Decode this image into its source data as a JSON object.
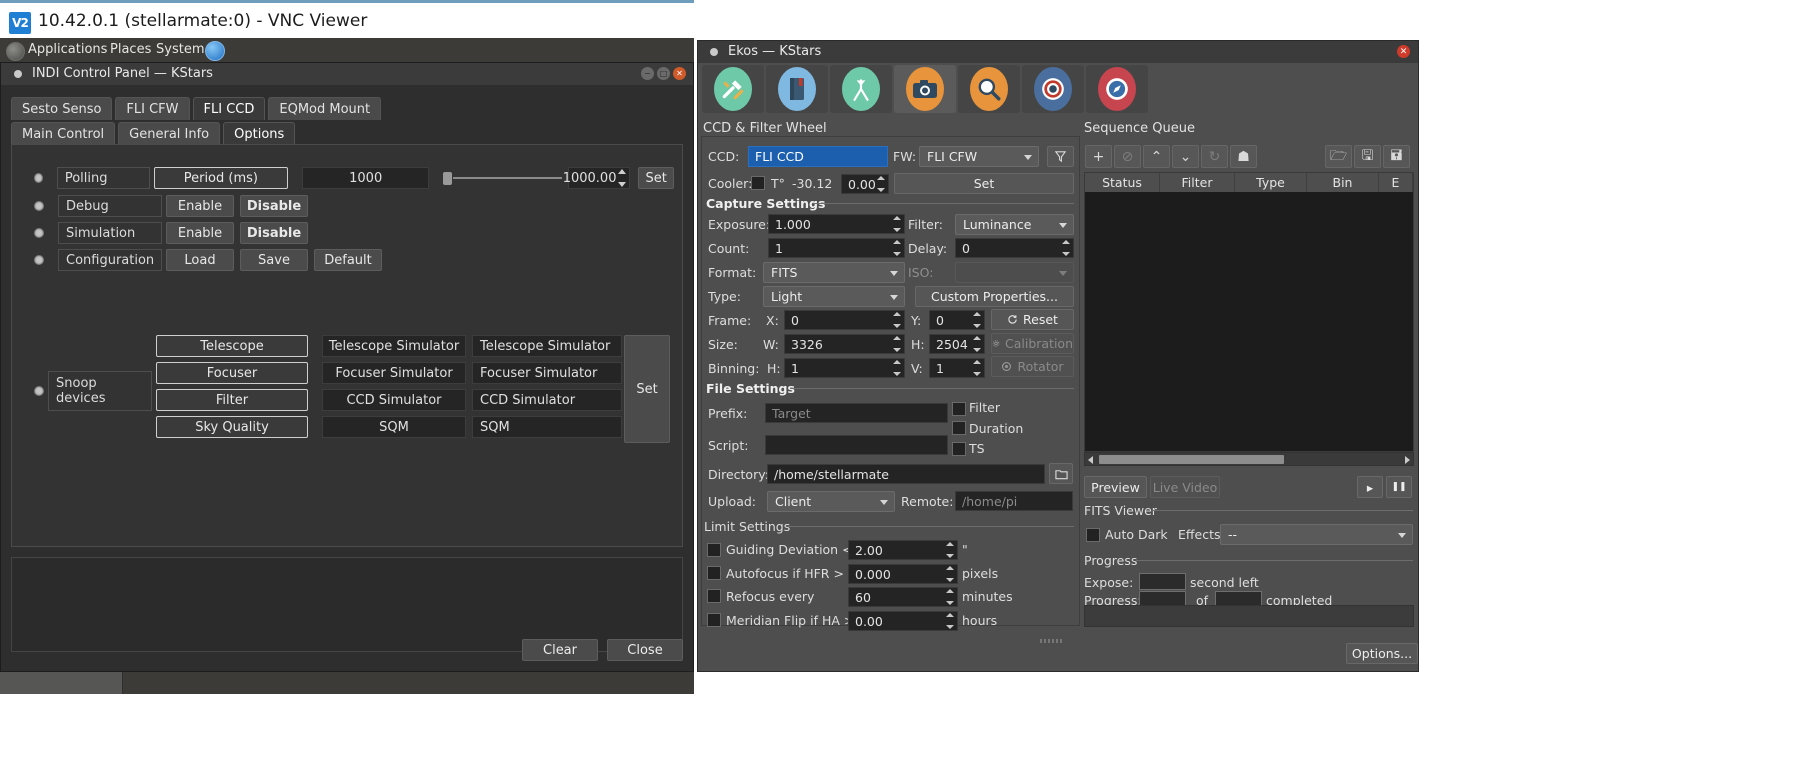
{
  "vnc": {
    "title": "10.42.0.1 (stellarmate:0) - VNC Viewer",
    "logo": "V2"
  },
  "gnome_panel": {
    "applications": "Applications",
    "places": "Places",
    "system": "System"
  },
  "indi_window": {
    "title": "INDI Control Panel — KStars",
    "device_tabs": [
      {
        "label": "Sesto Senso",
        "active": false
      },
      {
        "label": "FLI CFW",
        "active": false
      },
      {
        "label": "FLI CCD",
        "active": true
      },
      {
        "label": "EQMod Mount",
        "active": false
      }
    ],
    "sub_tabs": [
      {
        "label": "Main Control",
        "active": false
      },
      {
        "label": "General Info",
        "active": false
      },
      {
        "label": "Options",
        "active": true
      }
    ],
    "rows": {
      "polling": {
        "label": "Polling",
        "button": "Period (ms)",
        "value": "1000",
        "spin_value": "1000.00",
        "set": "Set"
      },
      "debug": {
        "label": "Debug",
        "enable": "Enable",
        "disable": "Disable"
      },
      "simulation": {
        "label": "Simulation",
        "enable": "Enable",
        "disable": "Disable"
      },
      "configuration": {
        "label": "Configuration",
        "load": "Load",
        "save": "Save",
        "default": "Default"
      },
      "snoop": {
        "label_line1": "Snoop",
        "label_line2": "devices",
        "set": "Set",
        "items": [
          {
            "name": "Telescope",
            "value": "Telescope Simulator",
            "current": "Telescope Simulator"
          },
          {
            "name": "Focuser",
            "value": "Focuser Simulator",
            "current": "Focuser Simulator"
          },
          {
            "name": "Filter",
            "value": "CCD Simulator",
            "current": "CCD Simulator"
          },
          {
            "name": "Sky Quality",
            "value": "SQM",
            "current": "SQM"
          }
        ]
      }
    },
    "footer": {
      "clear": "Clear",
      "close": "Close"
    }
  },
  "ekos": {
    "title": "Ekos — KStars",
    "modules": [
      {
        "name": "setup-module",
        "icon": "tools-icon",
        "active": false,
        "bg": "#6ec9a8"
      },
      {
        "name": "scheduler-module",
        "icon": "book-icon",
        "active": false,
        "bg": "#7fb8e0"
      },
      {
        "name": "mount-module",
        "icon": "tripod-icon",
        "active": false,
        "bg": "#6ec9a8"
      },
      {
        "name": "capture-module",
        "icon": "camera-icon",
        "active": true,
        "bg": "#e8943c"
      },
      {
        "name": "focus-module",
        "icon": "magnifier-icon",
        "active": false,
        "bg": "#e8943c"
      },
      {
        "name": "guide-module",
        "icon": "target-icon",
        "active": false,
        "bg": "#4a6f9e"
      },
      {
        "name": "align-module",
        "icon": "compass-icon",
        "active": false,
        "bg": "#c6454f"
      }
    ],
    "sections": {
      "ccd_filter_wheel": "CCD & Filter Wheel",
      "capture_settings": "Capture Settings",
      "file_settings": "File Settings",
      "limit_settings": "Limit Settings",
      "sequence_queue": "Sequence Queue",
      "fits_viewer": "FITS Viewer",
      "progress": "Progress"
    },
    "ccd": {
      "ccd_label": "CCD:",
      "ccd_value": "FLI CCD",
      "fw_label": "FW:",
      "fw_value": "FLI CFW",
      "filter_icon": "funnel-icon",
      "cooler_label": "Cooler:",
      "temp_symbol": "T°",
      "current_temp": "-30.12",
      "target_temp": "0.00",
      "set_button": "Set"
    },
    "capture": {
      "exposure_label": "Exposure:",
      "exposure_value": "1.000",
      "filter_label": "Filter:",
      "filter_value": "Luminance",
      "count_label": "Count:",
      "count_value": "1",
      "delay_label": "Delay:",
      "delay_value": "0",
      "format_label": "Format:",
      "format_value": "FITS",
      "iso_label": "ISO:",
      "iso_value": "",
      "type_label": "Type:",
      "type_value": "Light",
      "custom_properties": "Custom Properties...",
      "frame_label": "Frame:",
      "frame_x_label": "X:",
      "frame_x": "0",
      "frame_y_label": "Y:",
      "frame_y": "0",
      "reset_button": "Reset",
      "reset_icon": "reset-icon",
      "size_label": "Size:",
      "size_w_label": "W:",
      "size_w": "3326",
      "size_h_label": "H:",
      "size_h": "2504",
      "calibration_button": "Calibration",
      "calibration_icon": "gear-icon",
      "binning_label": "Binning:",
      "bin_h_label": "H:",
      "bin_h": "1",
      "bin_v_label": "V:",
      "bin_v": "1",
      "rotator_button": "Rotator",
      "rotator_icon": "rotator-icon"
    },
    "file": {
      "prefix_label": "Prefix:",
      "prefix_placeholder": "Target",
      "filter_check": "Filter",
      "duration_check": "Duration",
      "ts_check": "TS",
      "script_label": "Script:",
      "script_value": "",
      "directory_label": "Directory:",
      "directory_value": "/home/stellarmate",
      "browse_icon": "folder-icon",
      "upload_label": "Upload:",
      "upload_value": "Client",
      "remote_label": "Remote:",
      "remote_placeholder": "/home/pi"
    },
    "limits": [
      {
        "label": "Guiding Deviation <",
        "value": "2.00",
        "unit": "\""
      },
      {
        "label": "Autofocus if HFR >",
        "value": "0.000",
        "unit": "pixels"
      },
      {
        "label": "Refocus every",
        "value": "60",
        "unit": "minutes"
      },
      {
        "label": "Meridian Flip if HA >",
        "value": "0.00",
        "unit": "hours"
      }
    ],
    "sequence": {
      "toolbar_left": [
        {
          "name": "add-job-button",
          "icon": "plus-icon",
          "glyph": "+",
          "disabled": false
        },
        {
          "name": "remove-job-button",
          "icon": "no-entry-icon",
          "glyph": "⊘",
          "disabled": true
        },
        {
          "name": "move-up-button",
          "icon": "chevron-up-icon",
          "glyph": "⌃",
          "disabled": false
        },
        {
          "name": "move-down-button",
          "icon": "chevron-down-icon",
          "glyph": "⌄",
          "disabled": false
        },
        {
          "name": "reset-job-button",
          "icon": "refresh-icon",
          "glyph": "↻",
          "disabled": true
        },
        {
          "name": "job-profile-button",
          "icon": "person-icon",
          "glyph": "☗",
          "disabled": false
        }
      ],
      "toolbar_right": [
        {
          "name": "open-sequence-button",
          "icon": "folder-open-icon",
          "glyph": "🗁"
        },
        {
          "name": "save-sequence-button",
          "icon": "save-icon",
          "glyph": "🖫"
        },
        {
          "name": "save-as-sequence-button",
          "icon": "save-as-icon",
          "glyph": "🖬"
        }
      ],
      "columns": [
        "Status",
        "Filter",
        "Type",
        "Bin",
        "E"
      ],
      "rows": [],
      "start_button": {
        "name": "start-sequence-button",
        "icon": "play-icon",
        "glyph": "▸"
      },
      "pause_button": {
        "name": "pause-sequence-button",
        "icon": "pause-icon",
        "glyph": "❚❚"
      }
    },
    "preview": {
      "preview_button": "Preview",
      "live_video_button": "Live Video"
    },
    "fits_viewer": {
      "auto_dark_label": "Auto Dark",
      "effects_label": "Effects:",
      "effects_value": "--"
    },
    "progress": {
      "expose_label": "Expose:",
      "expose_value": "",
      "second_left_label": "second left",
      "progress_label": "Progress:",
      "progress_value": "",
      "of_label": "of",
      "total_value": "",
      "completed_label": "completed"
    },
    "options_button": "Options..."
  },
  "colors": {
    "window_bg": "#4e4e4e",
    "field_bg": "#242424",
    "highlight": "#1b5fae",
    "panel_dark": "#2e2e2e"
  }
}
